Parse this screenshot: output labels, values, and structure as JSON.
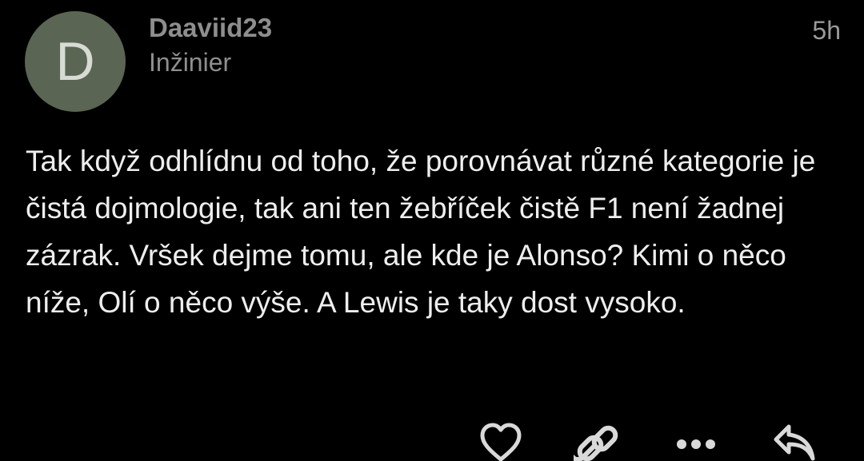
{
  "post": {
    "avatar_letter": "D",
    "avatar_color": "#5a6553",
    "username": "Daaviid23",
    "role": "Inžinier",
    "time": "5h",
    "body": "Tak když odhlídnu od toho, že porovnávat různé kategorie je čistá dojmologie, tak ani ten žebříček čistě F1 není žadnej zázrak. Vršek dejme tomu, ale kde je Alonso? Kimi o něco níže, Olí o něco výše. A Lewis je taky dost vysoko."
  },
  "actions": [
    {
      "icon": "heart-icon"
    },
    {
      "icon": "link-icon"
    },
    {
      "icon": "more-icon"
    },
    {
      "icon": "reply-icon"
    }
  ]
}
